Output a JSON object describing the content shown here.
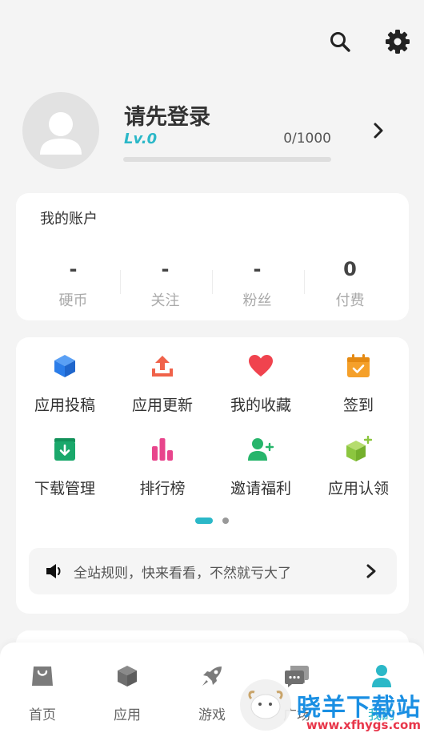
{
  "header": {
    "search_icon": "search-icon",
    "settings_icon": "gear-icon"
  },
  "profile": {
    "name": "请先登录",
    "level": "Lv.0",
    "xp_text": "0/1000",
    "xp_progress": 0
  },
  "account": {
    "title": "我的账户",
    "stats": [
      {
        "value": "-",
        "label": "硬币"
      },
      {
        "value": "-",
        "label": "关注"
      },
      {
        "value": "-",
        "label": "粉丝"
      },
      {
        "value": "0",
        "label": "付费"
      }
    ]
  },
  "features": [
    {
      "label": "应用投稿",
      "icon": "cube-icon",
      "color": "#2b7de9"
    },
    {
      "label": "应用更新",
      "icon": "upload-icon",
      "color": "#f0624a"
    },
    {
      "label": "我的收藏",
      "icon": "heart-icon",
      "color": "#f0434e"
    },
    {
      "label": "签到",
      "icon": "calendar-check-icon",
      "color": "#f5a02a"
    },
    {
      "label": "下载管理",
      "icon": "download-box-icon",
      "color": "#1aa86b"
    },
    {
      "label": "排行榜",
      "icon": "bar-chart-icon",
      "color": "#e8458c"
    },
    {
      "label": "邀请福利",
      "icon": "add-user-icon",
      "color": "#27b56b"
    },
    {
      "label": "应用认领",
      "icon": "cube-plus-icon",
      "color": "#8cc63f"
    }
  ],
  "pager": {
    "active": 0,
    "count": 2,
    "active_color": "#2bb8c8"
  },
  "notice": {
    "text": "全站规则，快来看看，不然就亏大了"
  },
  "tabs": [
    {
      "label": "首页",
      "icon": "bag-icon"
    },
    {
      "label": "应用",
      "icon": "box-icon"
    },
    {
      "label": "游戏",
      "icon": "rocket-icon"
    },
    {
      "label": "广场",
      "icon": "chat-icon"
    },
    {
      "label": "我的",
      "icon": "user-icon",
      "active": true
    }
  ],
  "watermark": {
    "title": "晓羊下载站",
    "url": "www.xfhygs.com"
  }
}
